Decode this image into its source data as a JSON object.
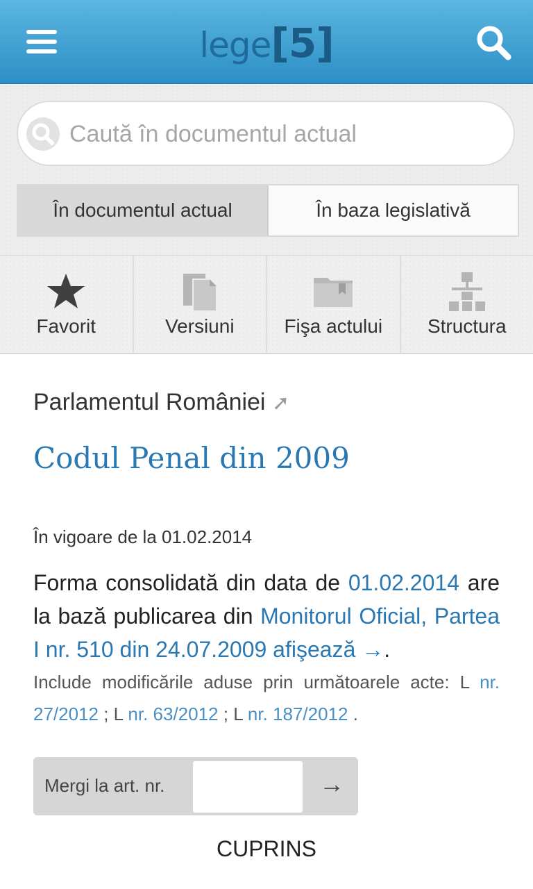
{
  "header": {
    "logo_text": "lege",
    "logo_number": "5"
  },
  "search": {
    "placeholder": "Caută în documentul actual",
    "scopes": [
      "În documentul actual",
      "În baza legislativă"
    ]
  },
  "toolbar": {
    "items": [
      "Favorit",
      "Versiuni",
      "Fişa actului",
      "Structura"
    ]
  },
  "document": {
    "issuer": "Parlamentul României",
    "title": "Codul Penal din 2009",
    "in_force": "În vigoare de la 01.02.2014",
    "consolidated_prefix": "Forma consolidată din data de",
    "consolidated_date": "01.02.2014",
    "based_on_text": "are la bază publicarea din",
    "publication_link": "Monitorul Oficial, Partea I nr. 510 din 24.07.2009 afişează →",
    "amendments_intro": "Include modificările aduse prin următoarele acte:",
    "amendments": [
      {
        "prefix": "L",
        "link": "nr. 27/2012"
      },
      {
        "prefix": "L",
        "link": "nr. 63/2012"
      },
      {
        "prefix": "L",
        "link": "nr. 187/2012"
      }
    ]
  },
  "goto": {
    "label": "Mergi la art. nr.",
    "arrow": "→"
  },
  "cuprins": "CUPRINS"
}
